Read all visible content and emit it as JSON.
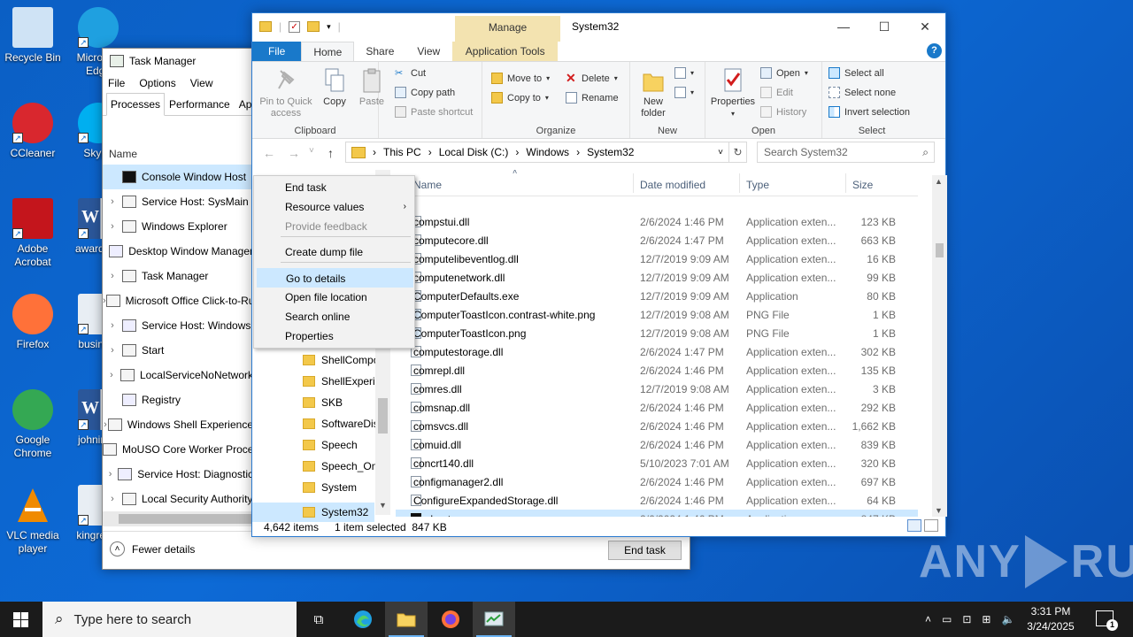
{
  "desktop": {
    "icons": [
      {
        "label": "Recycle Bin",
        "icon": "recycle-bin-icon"
      },
      {
        "label": "Microsoft Edge",
        "icon": "edge-icon"
      },
      {
        "label": "CCleaner",
        "icon": "ccleaner-icon"
      },
      {
        "label": "Skype",
        "icon": "skype-icon"
      },
      {
        "label": "Adobe Acrobat",
        "icon": "acrobat-icon"
      },
      {
        "label": "awardlo...",
        "icon": "word-doc-icon"
      },
      {
        "label": "Firefox",
        "icon": "firefox-icon"
      },
      {
        "label": "busine...",
        "icon": "image-file-icon"
      },
      {
        "label": "Google Chrome",
        "icon": "chrome-icon"
      },
      {
        "label": "johnire...",
        "icon": "word-doc-icon"
      },
      {
        "label": "VLC media player",
        "icon": "vlc-icon"
      },
      {
        "label": "kingrep...",
        "icon": "image-file-icon"
      }
    ],
    "watermark_left": "ANY",
    "watermark_right": "RUN"
  },
  "task_manager": {
    "title": "Task Manager",
    "menu": [
      "File",
      "Options",
      "View"
    ],
    "tabs": [
      "Processes",
      "Performance",
      "App history"
    ],
    "column_name": "Name",
    "rows": [
      {
        "name": "Console Window Host",
        "expandable": false,
        "selected": true
      },
      {
        "name": "Service Host: SysMain",
        "expandable": true
      },
      {
        "name": "Windows Explorer",
        "expandable": true
      },
      {
        "name": "Desktop Window Manager",
        "expandable": false
      },
      {
        "name": "Task Manager",
        "expandable": true
      },
      {
        "name": "Microsoft Office Click-to-Run",
        "expandable": true
      },
      {
        "name": "Service Host: Windows",
        "expandable": true
      },
      {
        "name": "Start",
        "expandable": true
      },
      {
        "name": "LocalServiceNoNetwork",
        "expandable": true
      },
      {
        "name": "Registry",
        "expandable": false
      },
      {
        "name": "Windows Shell Experience",
        "expandable": true
      },
      {
        "name": "MoUSO Core Worker Process",
        "expandable": false
      },
      {
        "name": "Service Host: Diagnostic",
        "expandable": true
      },
      {
        "name": "Local Security Authority",
        "expandable": true
      }
    ],
    "fewer_details": "Fewer details",
    "end_task": "End task"
  },
  "context_menu": {
    "items": [
      {
        "label": "End task"
      },
      {
        "label": "Resource values",
        "submenu": true
      },
      {
        "label": "Provide feedback",
        "disabled": true
      },
      {
        "label": "Create dump file"
      },
      {
        "label": "Go to details",
        "highlighted": true
      },
      {
        "label": "Open file location"
      },
      {
        "label": "Search online"
      },
      {
        "label": "Properties"
      }
    ]
  },
  "explorer": {
    "title": "System32",
    "manage_label": "Manage",
    "ribbon_tabs": [
      "File",
      "Home",
      "Share",
      "View",
      "Application Tools"
    ],
    "clipboard": {
      "pin": "Pin to Quick access",
      "copy": "Copy",
      "paste": "Paste",
      "cut": "Cut",
      "copy_path": "Copy path",
      "paste_shortcut": "Paste shortcut",
      "group": "Clipboard"
    },
    "organize": {
      "move_to": "Move to",
      "delete": "Delete",
      "copy_to": "Copy to",
      "rename": "Rename",
      "group": "Organize"
    },
    "new": {
      "new_folder": "New folder",
      "group": "New"
    },
    "open": {
      "properties": "Properties",
      "open": "Open",
      "edit": "Edit",
      "history": "History",
      "group": "Open"
    },
    "select": {
      "select_all": "Select all",
      "select_none": "Select none",
      "invert": "Invert selection",
      "group": "Select"
    },
    "breadcrumb": [
      "This PC",
      "Local Disk (C:)",
      "Windows",
      "System32"
    ],
    "search_placeholder": "Search System32",
    "nav_folders": [
      {
        "name": "ShellComponents"
      },
      {
        "name": "ShellExperiences"
      },
      {
        "name": "SKB"
      },
      {
        "name": "SoftwareDistribution"
      },
      {
        "name": "Speech"
      },
      {
        "name": "Speech_OneCore"
      },
      {
        "name": "System"
      },
      {
        "name": "System32",
        "selected": true
      }
    ],
    "columns": [
      "Name",
      "Date modified",
      "Type",
      "Size"
    ],
    "files": [
      {
        "name": "compstui.dll",
        "date": "2/6/2024 1:46 PM",
        "type": "Application exten...",
        "size": "123 KB"
      },
      {
        "name": "computecore.dll",
        "date": "2/6/2024 1:47 PM",
        "type": "Application exten...",
        "size": "663 KB"
      },
      {
        "name": "computelibeventlog.dll",
        "date": "12/7/2019 9:09 AM",
        "type": "Application exten...",
        "size": "16 KB"
      },
      {
        "name": "computenetwork.dll",
        "date": "12/7/2019 9:09 AM",
        "type": "Application exten...",
        "size": "99 KB"
      },
      {
        "name": "ComputerDefaults.exe",
        "date": "12/7/2019 9:09 AM",
        "type": "Application",
        "size": "80 KB"
      },
      {
        "name": "ComputerToastIcon.contrast-white.png",
        "date": "12/7/2019 9:08 AM",
        "type": "PNG File",
        "size": "1 KB"
      },
      {
        "name": "ComputerToastIcon.png",
        "date": "12/7/2019 9:08 AM",
        "type": "PNG File",
        "size": "1 KB"
      },
      {
        "name": "computestorage.dll",
        "date": "2/6/2024 1:47 PM",
        "type": "Application exten...",
        "size": "302 KB"
      },
      {
        "name": "comrepl.dll",
        "date": "2/6/2024 1:46 PM",
        "type": "Application exten...",
        "size": "135 KB"
      },
      {
        "name": "comres.dll",
        "date": "12/7/2019 9:08 AM",
        "type": "Application exten...",
        "size": "3 KB"
      },
      {
        "name": "comsnap.dll",
        "date": "2/6/2024 1:46 PM",
        "type": "Application exten...",
        "size": "292 KB"
      },
      {
        "name": "comsvcs.dll",
        "date": "2/6/2024 1:46 PM",
        "type": "Application exten...",
        "size": "1,662 KB"
      },
      {
        "name": "comuid.dll",
        "date": "2/6/2024 1:46 PM",
        "type": "Application exten...",
        "size": "839 KB"
      },
      {
        "name": "concrt140.dll",
        "date": "5/10/2023 7:01 AM",
        "type": "Application exten...",
        "size": "320 KB"
      },
      {
        "name": "configmanager2.dll",
        "date": "2/6/2024 1:46 PM",
        "type": "Application exten...",
        "size": "697 KB"
      },
      {
        "name": "ConfigureExpandedStorage.dll",
        "date": "2/6/2024 1:46 PM",
        "type": "Application exten...",
        "size": "64 KB"
      },
      {
        "name": "conhost.exe",
        "date": "2/6/2024 1:46 PM",
        "type": "Application",
        "size": "847 KB",
        "selected": true
      }
    ],
    "status_count": "4,642 items",
    "status_selected": "1 item selected  847 KB"
  },
  "taskbar": {
    "search_placeholder": "Type here to search",
    "time": "3:31 PM",
    "date": "3/24/2025",
    "notification_count": "1"
  }
}
